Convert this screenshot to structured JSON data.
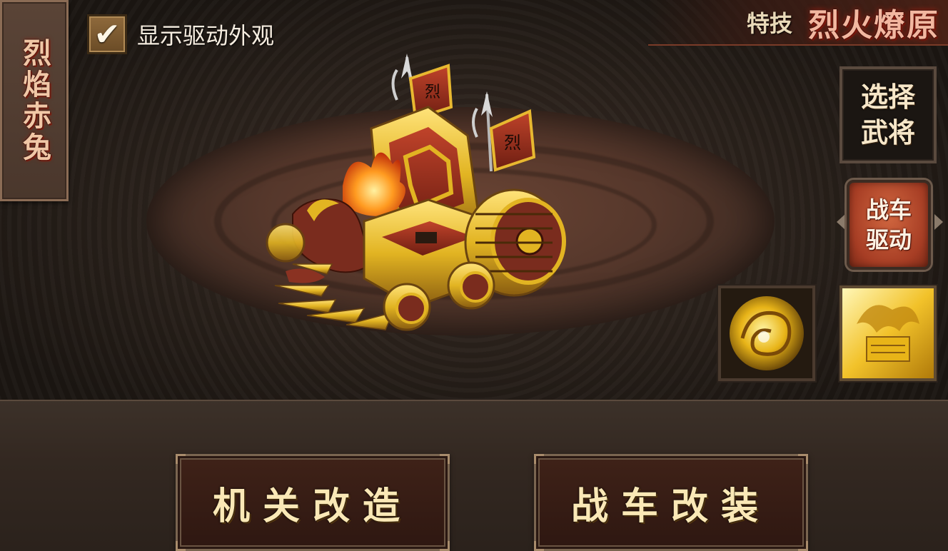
{
  "name_plaque": {
    "text": "烈焰赤兔"
  },
  "appearance_toggle": {
    "checked": true,
    "check_glyph": "✔",
    "label": "显示驱动外观"
  },
  "skill": {
    "label": "特技",
    "name": "烈火燎原"
  },
  "side_buttons": {
    "select_general": "选择武将",
    "chariot_drive": "战车驱动"
  },
  "bottom_buttons": {
    "mechanism_upgrade": "机关改造",
    "chariot_refit": "战车改装"
  },
  "chariot_flags": {
    "glyph": "烈"
  },
  "colors": {
    "gold": "#e2b422",
    "crimson": "#a63d24",
    "title_red": "#f3b7a0"
  }
}
